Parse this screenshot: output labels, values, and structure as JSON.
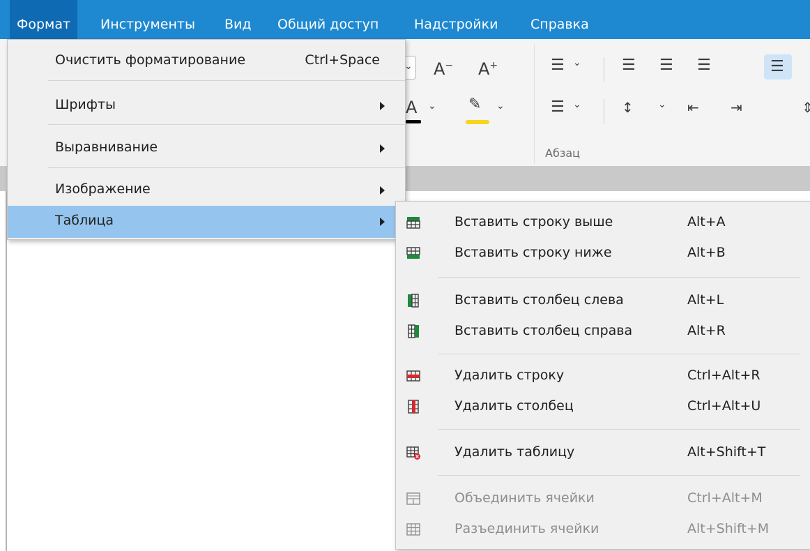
{
  "menubar": {
    "items": [
      {
        "label": "Формат"
      },
      {
        "label": "Инструменты"
      },
      {
        "label": "Вид"
      },
      {
        "label": "Общий доступ"
      },
      {
        "label": "Надстройки"
      },
      {
        "label": "Справка"
      }
    ]
  },
  "ribbon": {
    "group_label": "Абзац"
  },
  "format_menu": {
    "items": [
      {
        "label": "Очистить форматирование",
        "shortcut": "Ctrl+Space"
      },
      {
        "label": "Шрифты"
      },
      {
        "label": "Выравнивание"
      },
      {
        "label": "Изображение"
      },
      {
        "label": "Таблица"
      }
    ]
  },
  "table_submenu": {
    "items": [
      {
        "label": "Вставить строку выше",
        "shortcut": "Alt+A",
        "icon": "insert-row-above-icon"
      },
      {
        "label": "Вставить строку ниже",
        "shortcut": "Alt+B",
        "icon": "insert-row-below-icon"
      },
      {
        "label": "Вставить столбец слева",
        "shortcut": "Alt+L",
        "icon": "insert-column-left-icon"
      },
      {
        "label": "Вставить столбец справа",
        "shortcut": "Alt+R",
        "icon": "insert-column-right-icon"
      },
      {
        "label": "Удалить строку",
        "shortcut": "Ctrl+Alt+R",
        "icon": "delete-row-icon"
      },
      {
        "label": "Удалить столбец",
        "shortcut": "Ctrl+Alt+U",
        "icon": "delete-column-icon"
      },
      {
        "label": "Удалить таблицу",
        "shortcut": "Alt+Shift+T",
        "icon": "delete-table-icon"
      },
      {
        "label": "Объединить ячейки",
        "shortcut": "Ctrl+Alt+M",
        "icon": "merge-cells-icon",
        "disabled": true
      },
      {
        "label": "Разъединить ячейки",
        "shortcut": "Alt+Shift+M",
        "icon": "split-cells-icon",
        "disabled": true
      }
    ]
  },
  "colors": {
    "menubar": "#1e88d0",
    "highlight": "#95c5ee",
    "icon_green": "#1e8a3c",
    "icon_red": "#d9272e",
    "font_color_bar": "#000000",
    "highlighter_bar": "#f7d51d"
  }
}
